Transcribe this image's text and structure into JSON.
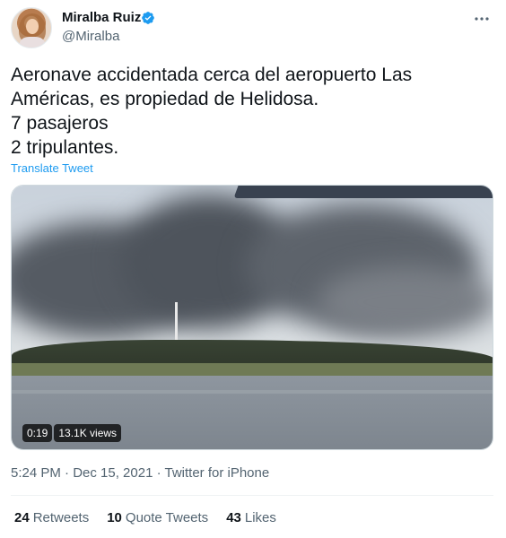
{
  "author": {
    "display_name": "Miralba Ruiz",
    "handle": "@Miralba",
    "verified_color": "#1d9bf0"
  },
  "tweet": {
    "text": "Aeronave accidentada cerca del aeropuerto Las Américas, es propiedad de Helidosa.\n7 pasajeros\n2 tripulantes.",
    "translate_label": "Translate Tweet"
  },
  "video": {
    "duration": "0:19",
    "views": "13.1K views"
  },
  "meta": {
    "timestamp": "5:24 PM · Dec 15, 2021 · Twitter for iPhone"
  },
  "stats": {
    "retweets_count": "24",
    "retweets_label": "Retweets",
    "quotes_count": "10",
    "quotes_label": "Quote Tweets",
    "likes_count": "43",
    "likes_label": "Likes"
  },
  "icons": {
    "verified": "verified-badge-icon",
    "more": "more-horizontal-icon"
  }
}
